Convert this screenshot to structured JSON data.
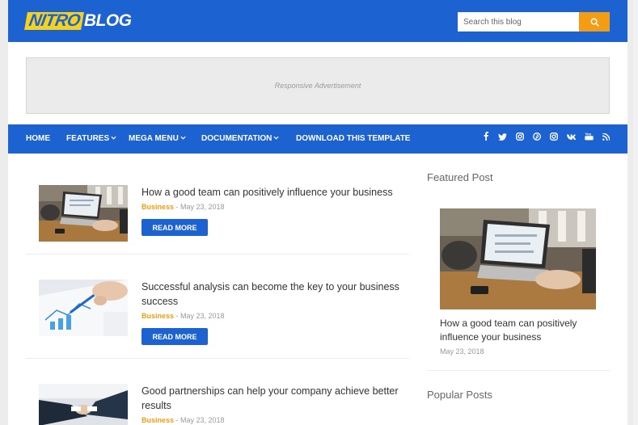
{
  "header": {
    "logo_part1": "NITRO",
    "logo_part2": "BLOG",
    "search_placeholder": "Search this blog",
    "search_icon": "search-icon"
  },
  "ad": {
    "text": "Responsive Advertisement"
  },
  "nav": {
    "items": [
      {
        "label": "Home"
      },
      {
        "label": "Features"
      },
      {
        "label": "Mega Menu"
      },
      {
        "label": "Documentation"
      },
      {
        "label": "Download This Template"
      }
    ],
    "social": [
      "f",
      "twitter-icon",
      "instagram-icon",
      "pinterest-icon",
      "instagram-icon",
      "vk-icon",
      "youtube-icon",
      "rss-icon"
    ]
  },
  "posts": [
    {
      "title": "How a good team can positively influence your business",
      "category": "Business",
      "date": "May 23, 2018",
      "button": "Read More"
    },
    {
      "title": "Successful analysis can become the key to your business success",
      "category": "Business",
      "date": "May 23, 2018",
      "button": "Read More"
    },
    {
      "title": "Good partnerships can help your company achieve better results",
      "category": "Business",
      "date": "May 23, 2018"
    }
  ],
  "meta_separator": " - ",
  "sidebar": {
    "featured_heading": "Featured Post",
    "featured_title": "How a good team can positively influence your business",
    "featured_date": "May 23, 2018",
    "popular_heading": "Popular Posts"
  },
  "colors": {
    "brand": "#1d62d1",
    "accent": "#f59c15",
    "logo_yellow": "#f8d21a"
  }
}
